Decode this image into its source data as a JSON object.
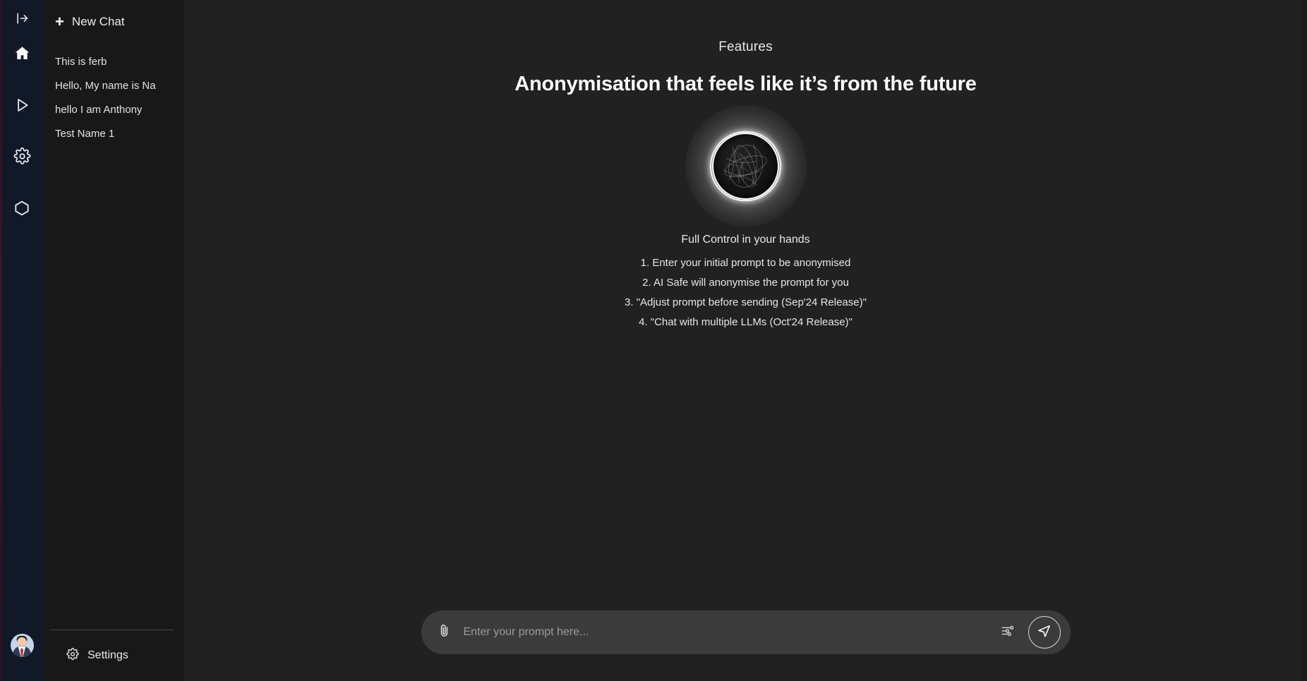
{
  "rail": {
    "collapse_icon": "panel-expand-icon",
    "items": [
      {
        "icon": "home-icon",
        "name": "home"
      },
      {
        "icon": "play-icon",
        "name": "play"
      },
      {
        "icon": "gear-icon",
        "name": "settings"
      },
      {
        "icon": "hexagon-icon",
        "name": "hexagon"
      }
    ],
    "avatar_label": "user-avatar"
  },
  "sidebar": {
    "new_chat_label": "New Chat",
    "new_chat_icon": "plus-icon",
    "chats": [
      {
        "title": "This is ferb"
      },
      {
        "title": "Hello, My name is Na"
      },
      {
        "title": "hello I am Anthony"
      },
      {
        "title": "Test Name 1"
      }
    ],
    "settings_label": "Settings",
    "settings_icon": "gear-icon"
  },
  "main": {
    "eyebrow": "Features",
    "headline": "Anonymisation that feels like it’s from the future",
    "orb_label": "globe-orb-graphic",
    "sub_head": "Full Control in your hands",
    "features": [
      "1. Enter your initial prompt to be anonymised",
      "2. AI Safe will anonymise the prompt for you",
      "3. \"Adjust prompt before sending (Sep'24 Release)\"",
      "4. \"Chat with multiple LLMs (Oct'24 Release)\""
    ]
  },
  "prompt": {
    "placeholder": "Enter your prompt here...",
    "value": "",
    "attach_icon": "paperclip-icon",
    "options_icon": "sliders-icon",
    "send_icon": "send-icon"
  },
  "colors": {
    "rail_bg": "#111827",
    "sidebar_bg": "#181818",
    "main_bg": "#212121",
    "prompt_bg": "#3b3b3b",
    "text_primary": "#ececec",
    "accent_edge": "#3a1626"
  }
}
